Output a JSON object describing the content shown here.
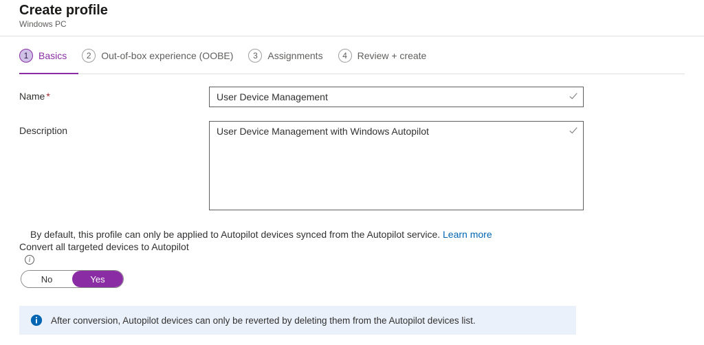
{
  "header": {
    "title": "Create profile",
    "subtitle": "Windows PC"
  },
  "tabs": [
    {
      "num": "1",
      "label": "Basics"
    },
    {
      "num": "2",
      "label": "Out-of-box experience (OOBE)"
    },
    {
      "num": "3",
      "label": "Assignments"
    },
    {
      "num": "4",
      "label": "Review + create"
    }
  ],
  "form": {
    "name_label": "Name",
    "name_value": "User Device Management",
    "description_label": "Description",
    "description_value": "User Device Management with Windows Autopilot"
  },
  "helper": {
    "default_text": "By default, this profile can only be applied to Autopilot devices synced from the Autopilot service. ",
    "learn_more": "Learn more",
    "convert_label": "Convert all targeted devices to Autopilot",
    "toggle": {
      "no": "No",
      "yes": "Yes"
    }
  },
  "banner": {
    "text": "After conversion, Autopilot devices can only be reverted by deleting them from the Autopilot devices list."
  }
}
